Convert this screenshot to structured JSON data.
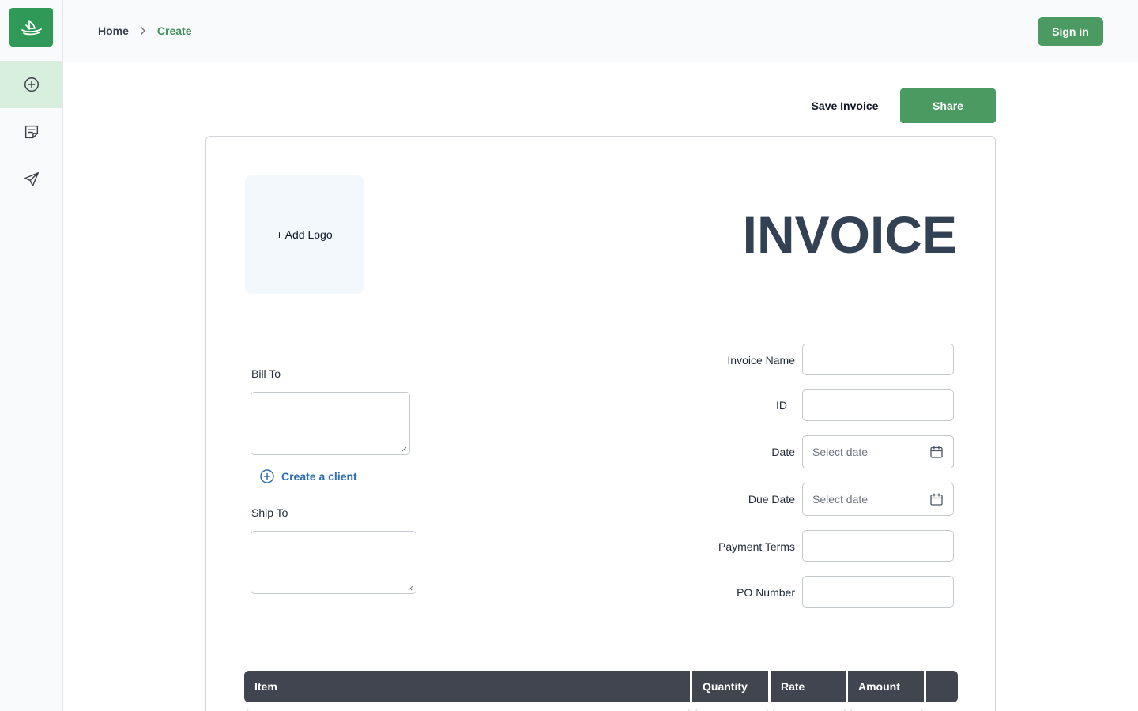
{
  "app": {
    "brand_color": "#2f9a57",
    "accent_color": "#4a9a62",
    "link_color": "#2c6fb4"
  },
  "sidebar": {
    "logo_icon": "boat-logo-icon",
    "items": [
      {
        "icon": "plus-circle-icon",
        "name": "create"
      },
      {
        "icon": "invoice-list-icon",
        "name": "invoices"
      },
      {
        "icon": "send-icon",
        "name": "sent"
      }
    ]
  },
  "breadcrumb": {
    "home": "Home",
    "current": "Create"
  },
  "header": {
    "signin_label": "Sign in"
  },
  "actions": {
    "save_label": "Save Invoice",
    "share_label": "Share"
  },
  "invoice": {
    "add_logo_label": "+ Add Logo",
    "title": "INVOICE",
    "bill_to_label": "Bill To",
    "create_client_label": "Create a client",
    "ship_to_label": "Ship To",
    "fields": {
      "invoice_name_label": "Invoice Name",
      "id_label": "ID",
      "date_label": "Date",
      "date_placeholder": "Select date",
      "due_date_label": "Due Date",
      "due_date_placeholder": "Select date",
      "payment_terms_label": "Payment Terms",
      "po_number_label": "PO Number"
    },
    "table": {
      "columns": [
        "Item",
        "Quantity",
        "Rate",
        "Amount",
        ""
      ]
    }
  }
}
